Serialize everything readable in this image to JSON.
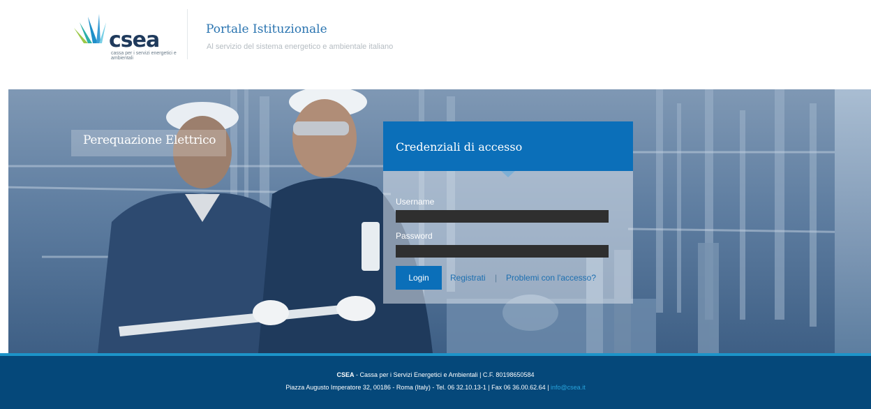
{
  "header": {
    "logo": {
      "word": "csea",
      "tagline": "cassa per i servizi energetici e ambientali"
    },
    "title": "Portale Istituzionale",
    "subtitle": "Al servizio del sistema energetico e ambientale italiano"
  },
  "hero": {
    "section_label": "Perequazione Elettrico"
  },
  "login": {
    "title": "Credenziali di accesso",
    "username_label": "Username",
    "username_value": "",
    "password_label": "Password",
    "password_value": "",
    "login_button": "Login",
    "register_link": "Registrati",
    "separator": "|",
    "problems_link": "Problemi con l'accesso?"
  },
  "footer": {
    "org_name": "CSEA",
    "line1_rest": " - Cassa per i Servizi Energetici e Ambientali | C.F. 80198650584",
    "line2": "Piazza Augusto Imperatore 32, 00186 - Roma (Italy) - Tel. 06 32.10.13-1 | Fax 06 36.00.62.64 | ",
    "email": "info@csea.it"
  },
  "colors": {
    "brand_blue": "#0b6fb9",
    "footer_bg": "#05487a",
    "footer_accent": "#1d94c9",
    "link": "#28a4dc"
  }
}
